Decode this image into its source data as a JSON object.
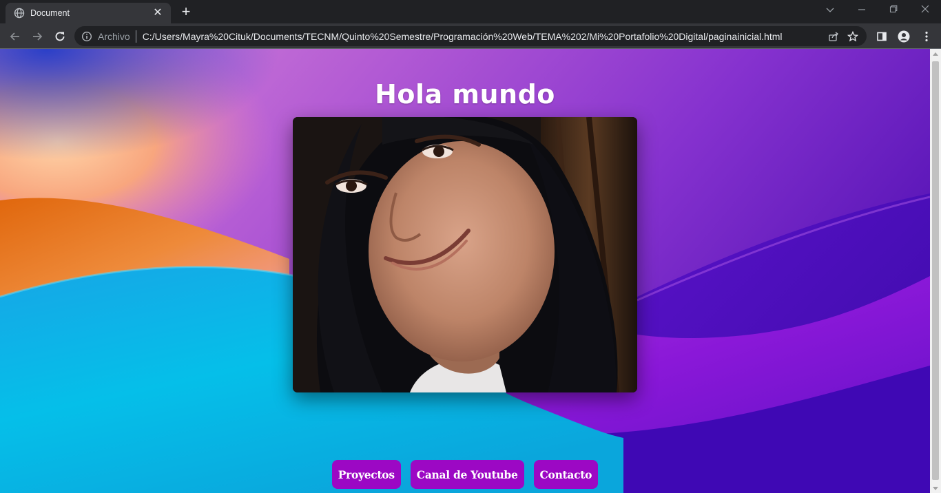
{
  "browser": {
    "tab_title": "Document",
    "omnibox_scheme": "Archivo",
    "url": "C:/Users/Mayra%20Cituk/Documents/TECNM/Quinto%20Semestre/Programación%20Web/TEMA%202/Mi%20Portafolio%20Digital/paginainicial.html"
  },
  "page": {
    "heading": "Hola mundo",
    "nav": [
      {
        "label": "Proyectos"
      },
      {
        "label": "Canal de Youtube"
      },
      {
        "label": "Contacto"
      }
    ],
    "colors": {
      "button_bg": "#9c08c4",
      "text": "#ffffff"
    }
  }
}
